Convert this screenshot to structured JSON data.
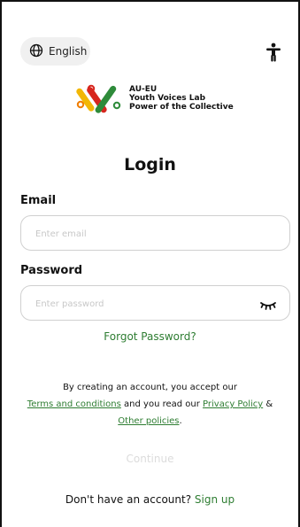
{
  "language": {
    "label": "English",
    "icon": "globe-icon"
  },
  "accessibility": {
    "icon": "accessibility-icon"
  },
  "brand": {
    "line1": "AU-EU",
    "line2": "Youth Voices Lab",
    "line3": "Power of the Collective",
    "colors": {
      "yellow": "#f2b705",
      "green": "#2e8b3a",
      "red": "#d7261e",
      "orange": "#f07d00"
    }
  },
  "title": "Login",
  "email": {
    "label": "Email",
    "placeholder": "Enter email",
    "value": ""
  },
  "password": {
    "label": "Password",
    "placeholder": "Enter password",
    "value": "",
    "toggle_icon": "eye-closed-icon"
  },
  "forgot_password": "Forgot Password?",
  "consent": {
    "prefix": "By creating an account, you accept our",
    "terms": "Terms and conditions",
    "middle": "and you read our",
    "privacy": "Privacy Policy",
    "amp": "&",
    "other": "Other policies",
    "period": "."
  },
  "continue_label": "Continue",
  "signup": {
    "prompt": "Don't have an account?",
    "link": "Sign up"
  },
  "colors": {
    "accent": "#2e7d32",
    "disabled": "#dcdcdc"
  }
}
